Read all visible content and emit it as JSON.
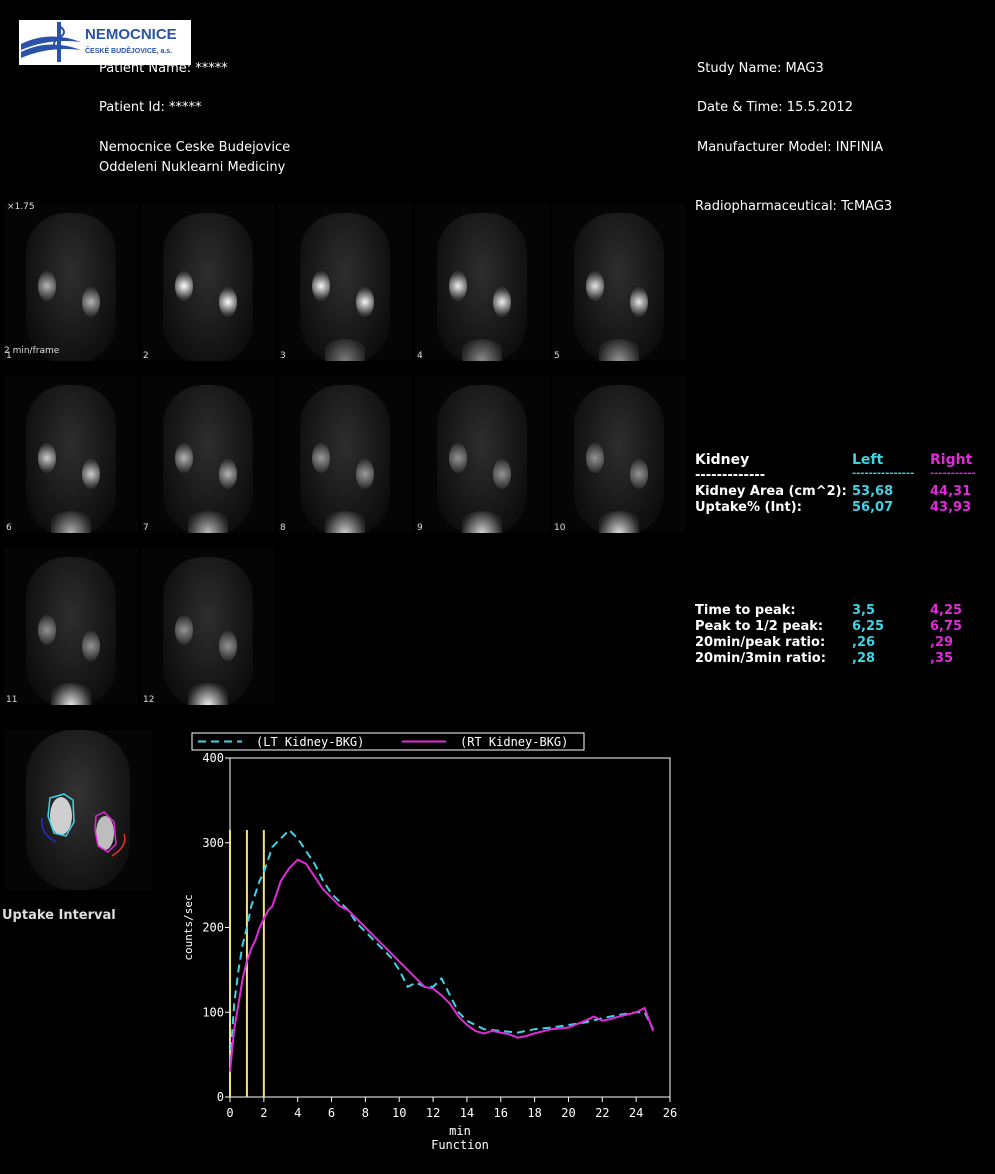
{
  "header": {
    "logo_text": "NEMOCNICE",
    "logo_subtext": "ČESKÉ BUDĚJOVICE, a.s.",
    "patient_name": "Patient Name: *****",
    "patient_id": "Patient Id: *****",
    "hospital_line1": "Nemocnice Ceske Budejovice",
    "hospital_line2": "Oddeleni Nuklearni Mediciny",
    "study_name": "Study Name: MAG3",
    "date_time": "Date & Time: 15.5.2012",
    "manufacturer": "Manufacturer Model: INFINIA",
    "radiopharm": "Radiopharmaceutical:  TcMAG3"
  },
  "frames": {
    "zoom": "×1.75",
    "rate": "2 min/frame",
    "labels": [
      "1",
      "2",
      "3",
      "4",
      "5",
      "6",
      "7",
      "8",
      "9",
      "10",
      "11",
      "12"
    ]
  },
  "table": {
    "header": {
      "kidney": "Kidney",
      "left": "Left",
      "right": "Right"
    },
    "dashes": {
      "kidney": "-------------",
      "left": "---------------",
      "right": "-----------"
    },
    "rows1": [
      {
        "label": "Kidney Area (cm^2):",
        "left": "53,68",
        "right": "44,31"
      },
      {
        "label": "Uptake% (Int):",
        "left": "56,07",
        "right": "43,93"
      }
    ],
    "rows2": [
      {
        "label": "Time to peak:",
        "left": "3,5",
        "right": "4,25"
      },
      {
        "label": "Peak to 1/2 peak:",
        "left": "6,25",
        "right": "6,75"
      },
      {
        "label": "20min/peak ratio:",
        "left": ",26",
        "right": ",29"
      },
      {
        "label": "20min/3min ratio:",
        "left": ",28",
        "right": ",35"
      }
    ]
  },
  "uptake_label": "Uptake Interval",
  "colors": {
    "left": "#3fd3e6",
    "right": "#e02ad8",
    "uptake_lines": "#f2e27a"
  },
  "chart_data": {
    "type": "line",
    "xlabel": "min",
    "ylabel": "counts/sec",
    "caption": "Function",
    "xlim": [
      0,
      26
    ],
    "ylim": [
      0,
      400
    ],
    "xticks": [
      0,
      2,
      4,
      6,
      8,
      10,
      12,
      14,
      16,
      18,
      20,
      22,
      24,
      26
    ],
    "yticks": [
      0,
      100,
      200,
      300,
      400
    ],
    "uptake_interval_x": [
      0,
      1,
      2
    ],
    "series": [
      {
        "name": "(LT Kidney-BKG)",
        "color": "#3fd3e6",
        "dash": true,
        "x": [
          0,
          0.25,
          0.5,
          0.75,
          1,
          1.25,
          1.5,
          1.75,
          2,
          2.25,
          2.5,
          3,
          3.5,
          4,
          4.5,
          5,
          5.5,
          6,
          6.5,
          7,
          7.5,
          8,
          8.5,
          9,
          9.5,
          10,
          10.5,
          11,
          11.5,
          12,
          12.5,
          13,
          13.5,
          14,
          14.5,
          15,
          16,
          17,
          18,
          19,
          20,
          21,
          22,
          23,
          24,
          24.5,
          25
        ],
        "y": [
          40,
          110,
          150,
          180,
          200,
          225,
          240,
          255,
          265,
          280,
          295,
          305,
          315,
          305,
          290,
          275,
          255,
          240,
          230,
          220,
          205,
          195,
          185,
          175,
          165,
          150,
          130,
          135,
          130,
          130,
          140,
          120,
          100,
          90,
          85,
          80,
          78,
          76,
          80,
          82,
          85,
          88,
          93,
          97,
          100,
          100,
          80
        ]
      },
      {
        "name": "(RT Kidney-BKG)",
        "color": "#e02ad8",
        "dash": false,
        "x": [
          0,
          0.25,
          0.5,
          0.75,
          1,
          1.25,
          1.5,
          1.75,
          2,
          2.25,
          2.5,
          3,
          3.5,
          4,
          4.5,
          5,
          5.5,
          6,
          6.5,
          7,
          7.5,
          8,
          8.5,
          9,
          9.5,
          10,
          10.5,
          11,
          11.5,
          12,
          12.5,
          13,
          13.5,
          14,
          14.5,
          15,
          15.5,
          16,
          16.5,
          17,
          17.5,
          18,
          19,
          20,
          21,
          21.5,
          22,
          22.5,
          23,
          24,
          24.5,
          25
        ],
        "y": [
          30,
          80,
          110,
          140,
          160,
          175,
          185,
          200,
          210,
          220,
          225,
          255,
          270,
          280,
          275,
          260,
          245,
          235,
          225,
          220,
          210,
          200,
          190,
          180,
          170,
          160,
          150,
          140,
          130,
          128,
          120,
          110,
          95,
          85,
          78,
          75,
          78,
          76,
          74,
          70,
          72,
          75,
          80,
          82,
          90,
          95,
          90,
          92,
          95,
          100,
          105,
          78
        ]
      }
    ]
  }
}
